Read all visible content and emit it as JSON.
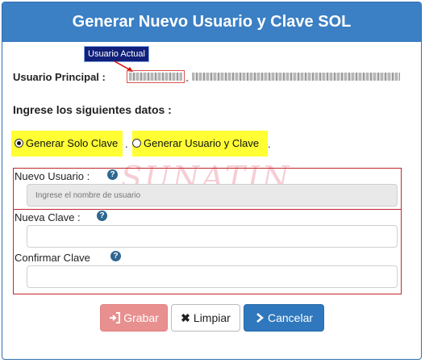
{
  "header": {
    "title": "Generar Nuevo Usuario y Clave SOL"
  },
  "annotation": {
    "usuario_actual": "Usuario Actual"
  },
  "usuario_principal": {
    "label": "Usuario Principal :",
    "separator": "-"
  },
  "section": {
    "title": "Ingrese los siguientes datos :"
  },
  "radios": [
    {
      "label": "Generar Solo Clave",
      "checked": true
    },
    {
      "label": "Generar Usuario y Clave",
      "checked": false
    }
  ],
  "radio_separator": ".",
  "watermark": "SUNATIN",
  "fields": {
    "nuevo_usuario": {
      "label": "Nuevo Usuario :",
      "placeholder": "Ingrese el nombre de usuario"
    },
    "nueva_clave": {
      "label": "Nueva Clave :"
    },
    "confirmar_clave": {
      "label": "Confirmar Clave"
    }
  },
  "buttons": {
    "grabar": {
      "label": "Grabar",
      "icon": "sign-in-icon"
    },
    "limpiar": {
      "label": "Limpiar",
      "icon": "x-icon"
    },
    "cancelar": {
      "label": "Cancelar",
      "icon": "chevron-right-icon"
    }
  },
  "colors": {
    "header": "#3b7fc4",
    "highlight": "#ffff33",
    "red_box": "#c0282d",
    "grabar": "#e8908f",
    "cancelar": "#2f78bd"
  }
}
